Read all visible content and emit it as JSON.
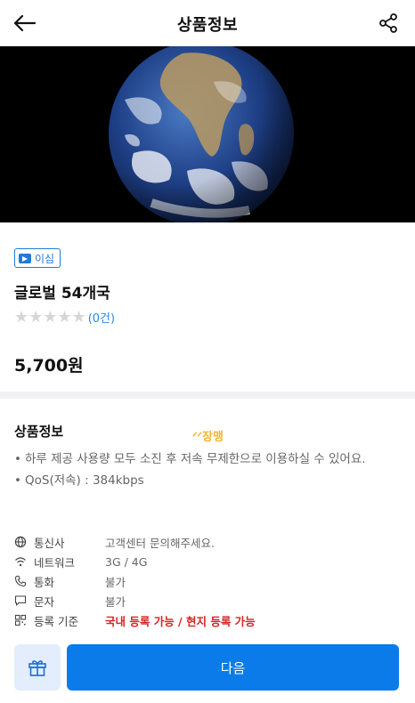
{
  "header": {
    "title": "상품정보",
    "back_icon": "arrow-left-icon",
    "share_icon": "share-icon"
  },
  "hero": {
    "image": "earth-globe-photo"
  },
  "product": {
    "badge": "이심",
    "name": "글로벌 54개국",
    "stars": "★★★★★",
    "rating_value": 0,
    "review_count": "(0건)",
    "price": "5,700원"
  },
  "detail": {
    "section_title": "상품정보",
    "brand_logo": "ᐟᐟ장맹",
    "bullets": [
      "하루 제공 사용량 모두 소진 후 저속 무제한으로 이용하실 수 있어요.",
      "QoS(저속) : 384kbps"
    ],
    "specs": [
      {
        "icon": "globe-icon",
        "label": "통신사",
        "value": "고객센터 문의해주세요."
      },
      {
        "icon": "wifi-icon",
        "label": "네트워크",
        "value": "3G / 4G"
      },
      {
        "icon": "phone-icon",
        "label": "통화",
        "value": "불가"
      },
      {
        "icon": "message-icon",
        "label": "문자",
        "value": "불가"
      },
      {
        "icon": "qr-icon",
        "label": "등록 기준",
        "value": "국내 등록 가능 / 현지 등록 가능"
      }
    ]
  },
  "footer": {
    "gift_icon": "gift-icon",
    "next_label": "다음"
  },
  "colors": {
    "accent": "#0b7bea",
    "link": "#2f86e8",
    "warning": "#d92323",
    "divider": "#f2f2f4"
  }
}
